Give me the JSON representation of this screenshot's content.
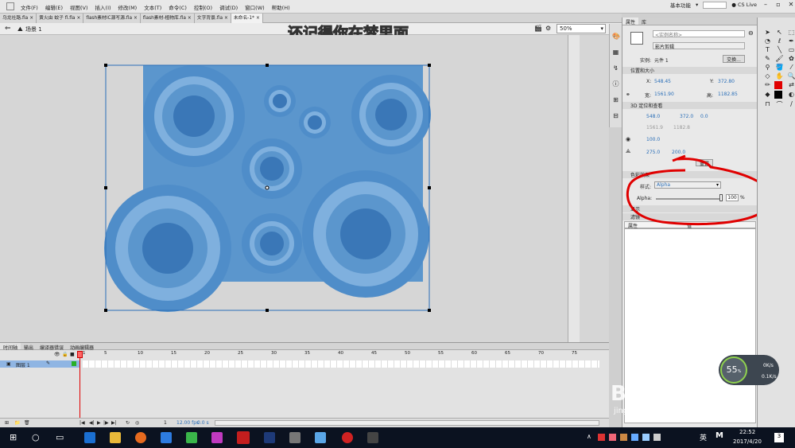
{
  "menubar": {
    "items": [
      "文件(F)",
      "编辑(E)",
      "视图(V)",
      "插入(I)",
      "修改(M)",
      "文本(T)",
      "命令(C)",
      "控制(O)",
      "调试(D)",
      "窗口(W)",
      "帮助(H)"
    ],
    "workspace": "基本功能",
    "cs_live": "CS Live"
  },
  "doc_tabs": [
    {
      "label": "乌龙社路.fla",
      "active": false
    },
    {
      "label": "黄火由 蚊子 fl.fla",
      "active": false
    },
    {
      "label": "flash素材IC源写源.fla",
      "active": false
    },
    {
      "label": "flash素材-植物库.fla",
      "active": false
    },
    {
      "label": "文字背景.fla",
      "active": false
    },
    {
      "label": "未命名-1*",
      "active": true
    }
  ],
  "scene": {
    "label": "场景 1",
    "zoom": "50%"
  },
  "overlay_caption": "还记得你在梦里面",
  "properties": {
    "tabs": [
      "属性",
      "库"
    ],
    "instance_name_placeholder": "<实例名称>",
    "symbol_type": "影片剪辑",
    "instance_of_label": "实例:",
    "instance_of_value": "元件 1",
    "swap_button": "交换...",
    "section_pos": "位置和大小",
    "x_label": "X:",
    "x": "548.45",
    "y_label": "Y:",
    "y": "372.80",
    "w_label": "宽:",
    "w": "1561.90",
    "h_label": "高:",
    "h": "1182.85",
    "section_3d": "3D 定位和查看",
    "x3": "548.0",
    "y3": "372.0",
    "z3": "0.0",
    "w3": "1561.9",
    "h3": "1182.8",
    "persp": "100.0",
    "vx": "275.0",
    "vy": "200.0",
    "reset_button": "重置",
    "section_color": "色彩效果",
    "style_label": "样式:",
    "style_value": "Alpha",
    "alpha_label": "Alpha:",
    "alpha_value": "100",
    "alpha_unit": "%",
    "alpha_level": 1.0,
    "section_display": "显示",
    "section_filters": "滤镜",
    "filter_col1": "属性",
    "filter_col2": "值"
  },
  "timeline": {
    "tabs": [
      "时间轴",
      "输出",
      "编译器错误",
      "动画编辑器"
    ],
    "layer_name": "图层 1",
    "frame_numbers": [
      "1",
      "5",
      "10",
      "15",
      "20",
      "25",
      "30",
      "35",
      "40",
      "45",
      "50",
      "55",
      "60",
      "65",
      "70",
      "75"
    ],
    "fps": "12.00 fps",
    "time": "0.0 s",
    "current_frame": "1"
  },
  "watermark": {
    "brand": "Baidu经验",
    "url": "jingyan.baidu.com"
  },
  "net_widget": {
    "percent": "55",
    "unit": "%",
    "down": "0K/s",
    "up": "0.1K/s"
  },
  "taskbar": {
    "ime": "英",
    "time": "22:52",
    "date": "2017/4/20",
    "notif": "3"
  },
  "colors": {
    "accent_red": "#e00000",
    "shape_blue": "#5b96cd",
    "circle_light": "#7fb0de",
    "circle_dark": "#3a77b7"
  }
}
